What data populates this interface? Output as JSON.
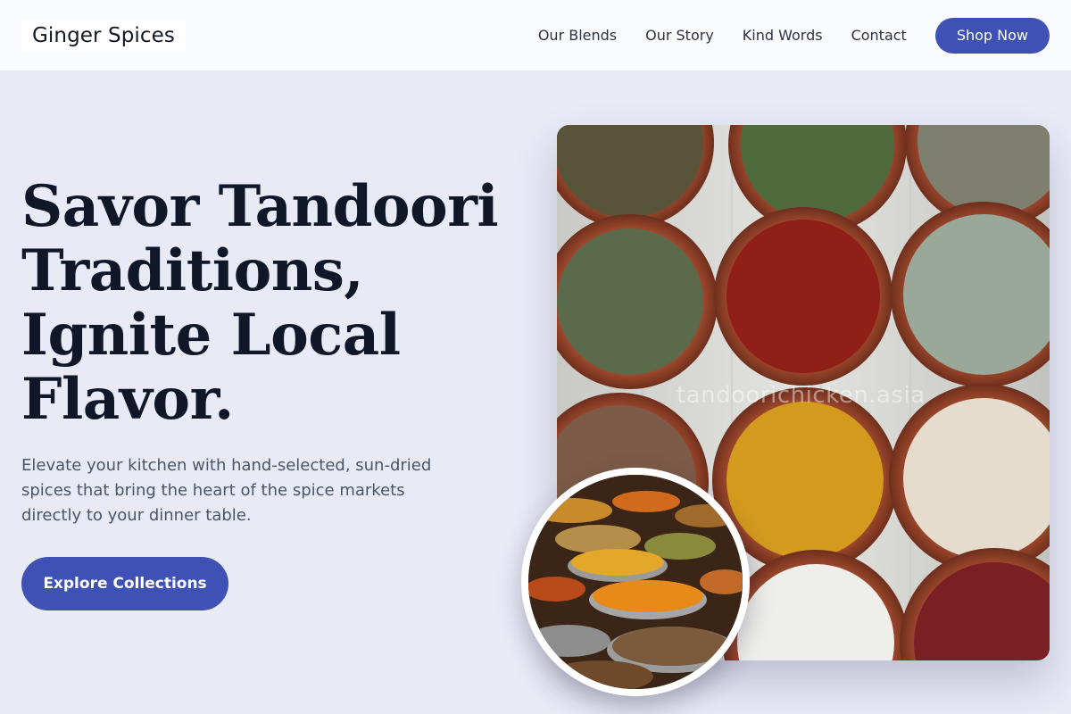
{
  "header": {
    "logo": "Ginger Spices",
    "nav": [
      "Our Blends",
      "Our Story",
      "Kind Words",
      "Contact"
    ],
    "cta": "Shop Now"
  },
  "hero": {
    "title_lines": [
      "Savor Tandoori",
      "Traditions,",
      "Ignite Local",
      "Flavor."
    ],
    "subtitle": "Elevate your kitchen with hand-selected, sun-dried spices that bring the heart of the spice markets directly to your dinner table.",
    "cta": "Explore Collections"
  },
  "images": {
    "main_watermark": "tandoorichicken.asia",
    "inset_watermark": "tandoorichicken.asia"
  },
  "colors": {
    "accent": "#3f51b5",
    "background": "#e8eaf6",
    "heading": "#0f1729"
  }
}
